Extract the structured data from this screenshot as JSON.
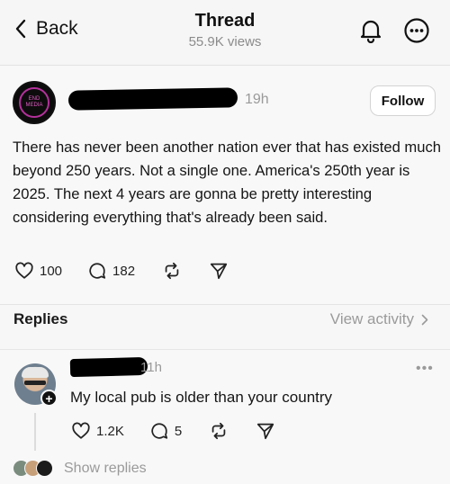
{
  "header": {
    "back_label": "Back",
    "title": "Thread",
    "views": "55.9K views"
  },
  "post": {
    "avatar_text": "END MEDIA",
    "time": "19h",
    "follow_label": "Follow",
    "text": "There has never been another nation ever that has existed much beyond 250 years. Not a single one. America's 250th year is 2025. The next 4 years are gonna be pretty interesting considering everything that's already been said.",
    "likes": "100",
    "comments": "182"
  },
  "replies_section": {
    "title": "Replies",
    "view_activity": "View activity"
  },
  "reply": {
    "time": "11h",
    "more": "•••",
    "text": "My local pub is older than your country",
    "likes": "1.2K",
    "comments": "5",
    "show_replies": "Show replies"
  },
  "colors": {
    "background": "#f4f4f4",
    "muted_text": "#9a9a9a",
    "avatar_accent": "#b3319b"
  }
}
